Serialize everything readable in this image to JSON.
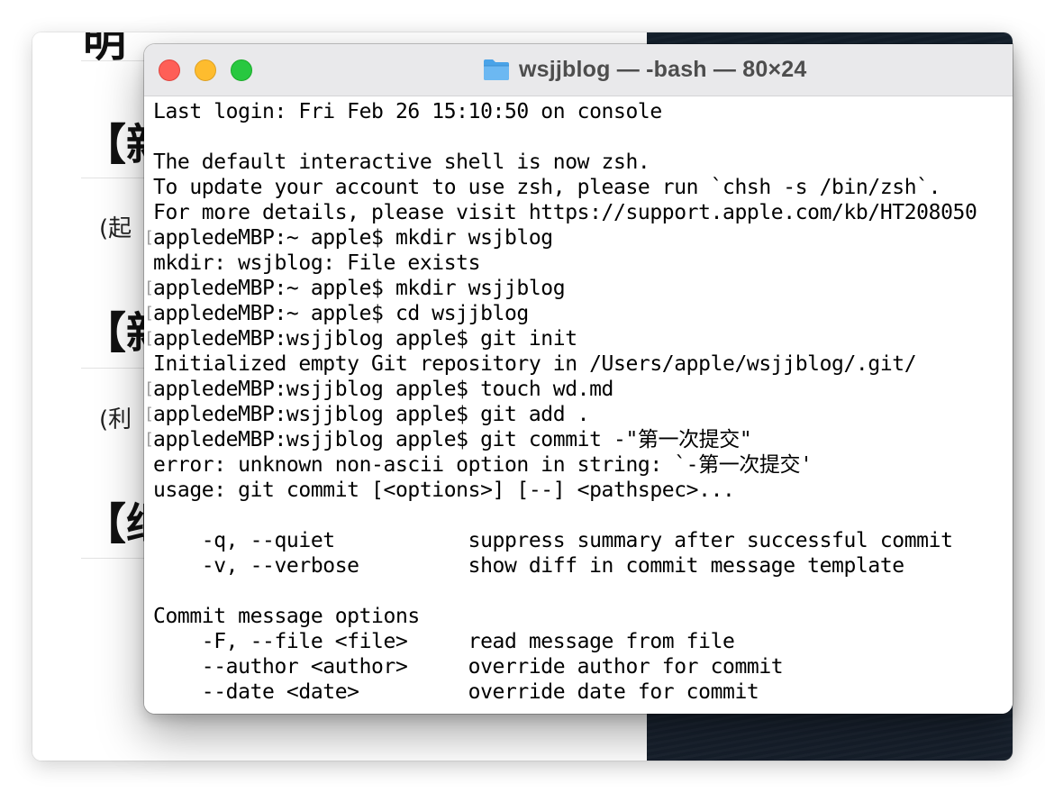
{
  "background_document": {
    "headings": [
      "明",
      "【新",
      "【新",
      "【继"
    ],
    "paragraphs": [
      "(起",
      "(利"
    ]
  },
  "terminal": {
    "folder_icon": "folder-icon",
    "title": "wsjjblog — -bash — 80×24",
    "prompt_bracket": "[",
    "lines": [
      "Last login: Fri Feb 26 15:10:50 on console",
      "",
      "The default interactive shell is now zsh.",
      "To update your account to use zsh, please run `chsh -s /bin/zsh`.",
      "For more details, please visit https://support.apple.com/kb/HT208050",
      "appledeMBP:~ apple$ mkdir wsjblog",
      "mkdir: wsjblog: File exists",
      "appledeMBP:~ apple$ mkdir wsjjblog",
      "appledeMBP:~ apple$ cd wsjjblog",
      "appledeMBP:wsjjblog apple$ git init",
      "Initialized empty Git repository in /Users/apple/wsjjblog/.git/",
      "appledeMBP:wsjjblog apple$ touch wd.md",
      "appledeMBP:wsjjblog apple$ git add .",
      "appledeMBP:wsjjblog apple$ git commit -\"第一次提交\"",
      "error: unknown non-ascii option in string: `-第一次提交'",
      "usage: git commit [<options>] [--] <pathspec>...",
      "",
      "    -q, --quiet           suppress summary after successful commit",
      "    -v, --verbose         show diff in commit message template",
      "",
      "Commit message options",
      "    -F, --file <file>     read message from file",
      "    --author <author>     override author for commit",
      "    --date <date>         override date for commit"
    ]
  }
}
